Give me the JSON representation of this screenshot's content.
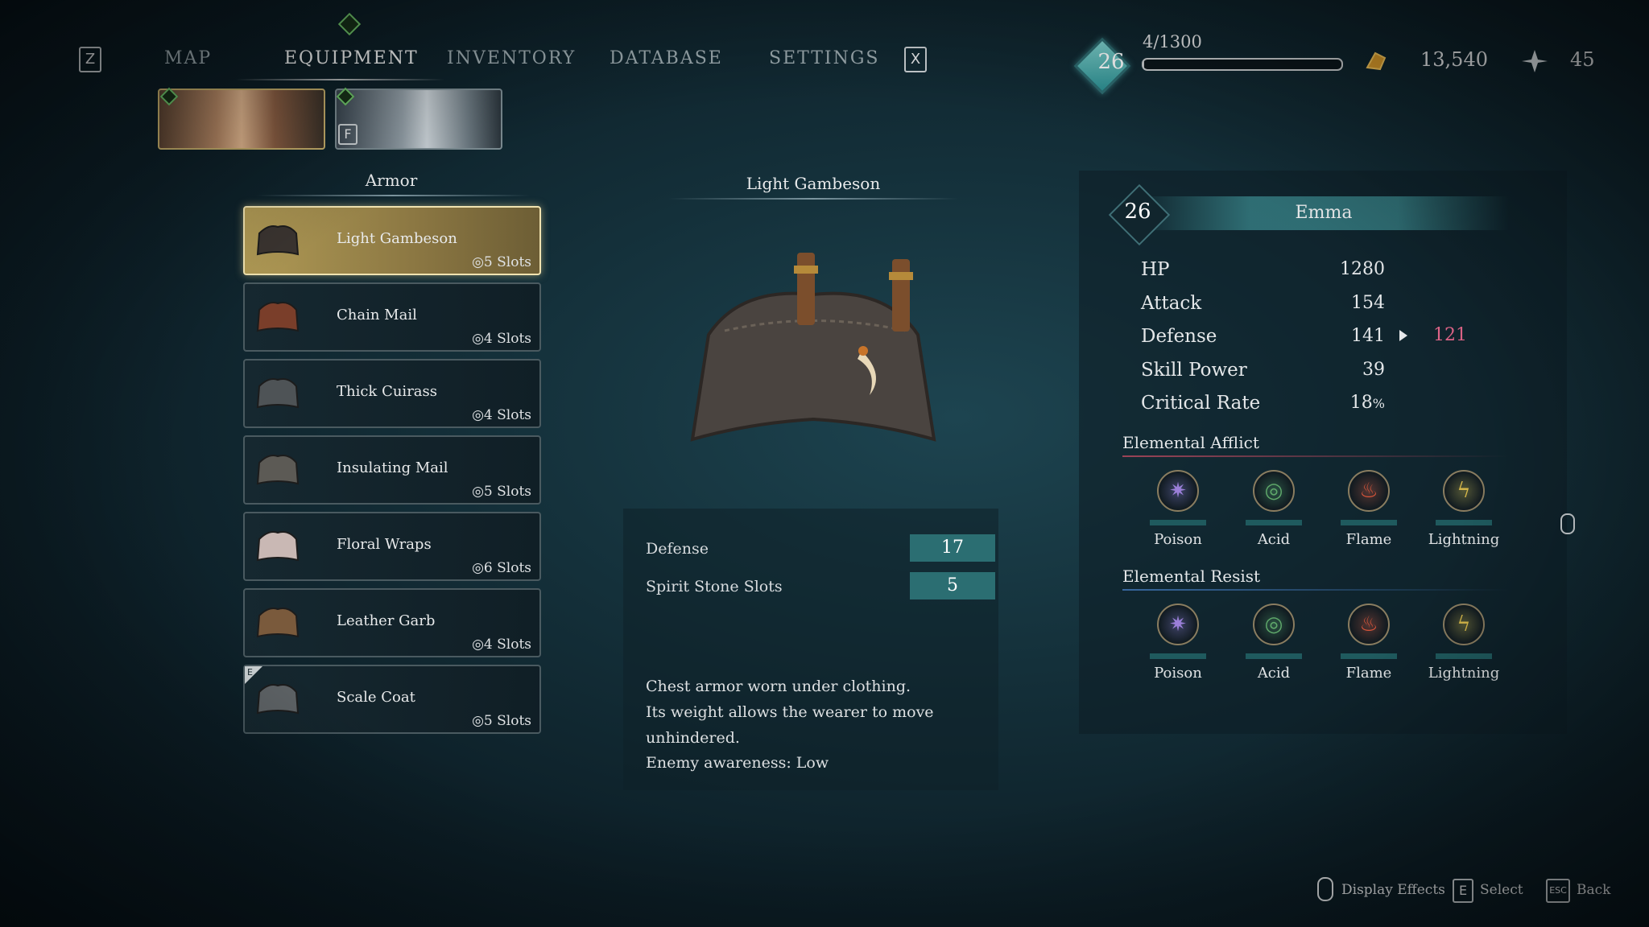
{
  "nav": {
    "left_key": "Z",
    "right_key": "X",
    "tabs": [
      {
        "label": "MAP"
      },
      {
        "label": "EQUIPMENT"
      },
      {
        "label": "INVENTORY"
      },
      {
        "label": "DATABASE"
      },
      {
        "label": "SETTINGS"
      }
    ],
    "active_tab": "EQUIPMENT"
  },
  "status": {
    "level": "26",
    "xp_text": "4/1300",
    "xp_fraction": 0.003,
    "currency": "13,540",
    "skill_points": "45"
  },
  "party": {
    "companion_key": "F"
  },
  "armor_list": {
    "title": "Armor",
    "items": [
      {
        "name": "Light Gambeson",
        "slots": "5 Slots",
        "selected": true,
        "equipped_tag": ""
      },
      {
        "name": "Chain Mail",
        "slots": "4 Slots",
        "selected": false,
        "equipped_tag": ""
      },
      {
        "name": "Thick Cuirass",
        "slots": "4 Slots",
        "selected": false,
        "equipped_tag": ""
      },
      {
        "name": "Insulating Mail",
        "slots": "5 Slots",
        "selected": false,
        "equipped_tag": ""
      },
      {
        "name": "Floral Wraps",
        "slots": "6 Slots",
        "selected": false,
        "equipped_tag": ""
      },
      {
        "name": "Leather Garb",
        "slots": "4 Slots",
        "selected": false,
        "equipped_tag": ""
      },
      {
        "name": "Scale Coat",
        "slots": "5 Slots",
        "selected": false,
        "equipped_tag": "E"
      }
    ]
  },
  "item_detail": {
    "title": "Light Gambeson",
    "stats": [
      {
        "label": "Defense",
        "value": "17"
      },
      {
        "label": "Spirit Stone Slots",
        "value": "5"
      }
    ],
    "description": [
      "Chest armor worn under clothing.",
      "Its weight allows the wearer to move",
      "unhindered.",
      "Enemy awareness: Low"
    ]
  },
  "character": {
    "level": "26",
    "name": "Emma",
    "stats": [
      {
        "label": "HP",
        "value": "1280",
        "new_value": ""
      },
      {
        "label": "Attack",
        "value": "154",
        "new_value": ""
      },
      {
        "label": "Defense",
        "value": "141",
        "new_value": "121"
      },
      {
        "label": "Skill Power",
        "value": "39",
        "new_value": ""
      },
      {
        "label": "Critical Rate",
        "value": "18",
        "unit": "%",
        "new_value": ""
      }
    ],
    "afflict_title": "Elemental Afflict",
    "resist_title": "Elemental Resist",
    "elements": [
      {
        "label": "Poison",
        "color": "#9b7fd8",
        "glyph": "✷"
      },
      {
        "label": "Acid",
        "color": "#5fa86a",
        "glyph": "◎"
      },
      {
        "label": "Flame",
        "color": "#d8553a",
        "glyph": "♨"
      },
      {
        "label": "Lightning",
        "color": "#d8b94a",
        "glyph": "ϟ"
      }
    ]
  },
  "hints": {
    "display_effects": "Display Effects",
    "select_key": "E",
    "select": "Select",
    "back_key": "ESC",
    "back": "Back"
  },
  "colors": {
    "accent_teal": "#2b6e72",
    "selected_gold": "#b09a55",
    "decrease_pink": "#e2668a"
  }
}
